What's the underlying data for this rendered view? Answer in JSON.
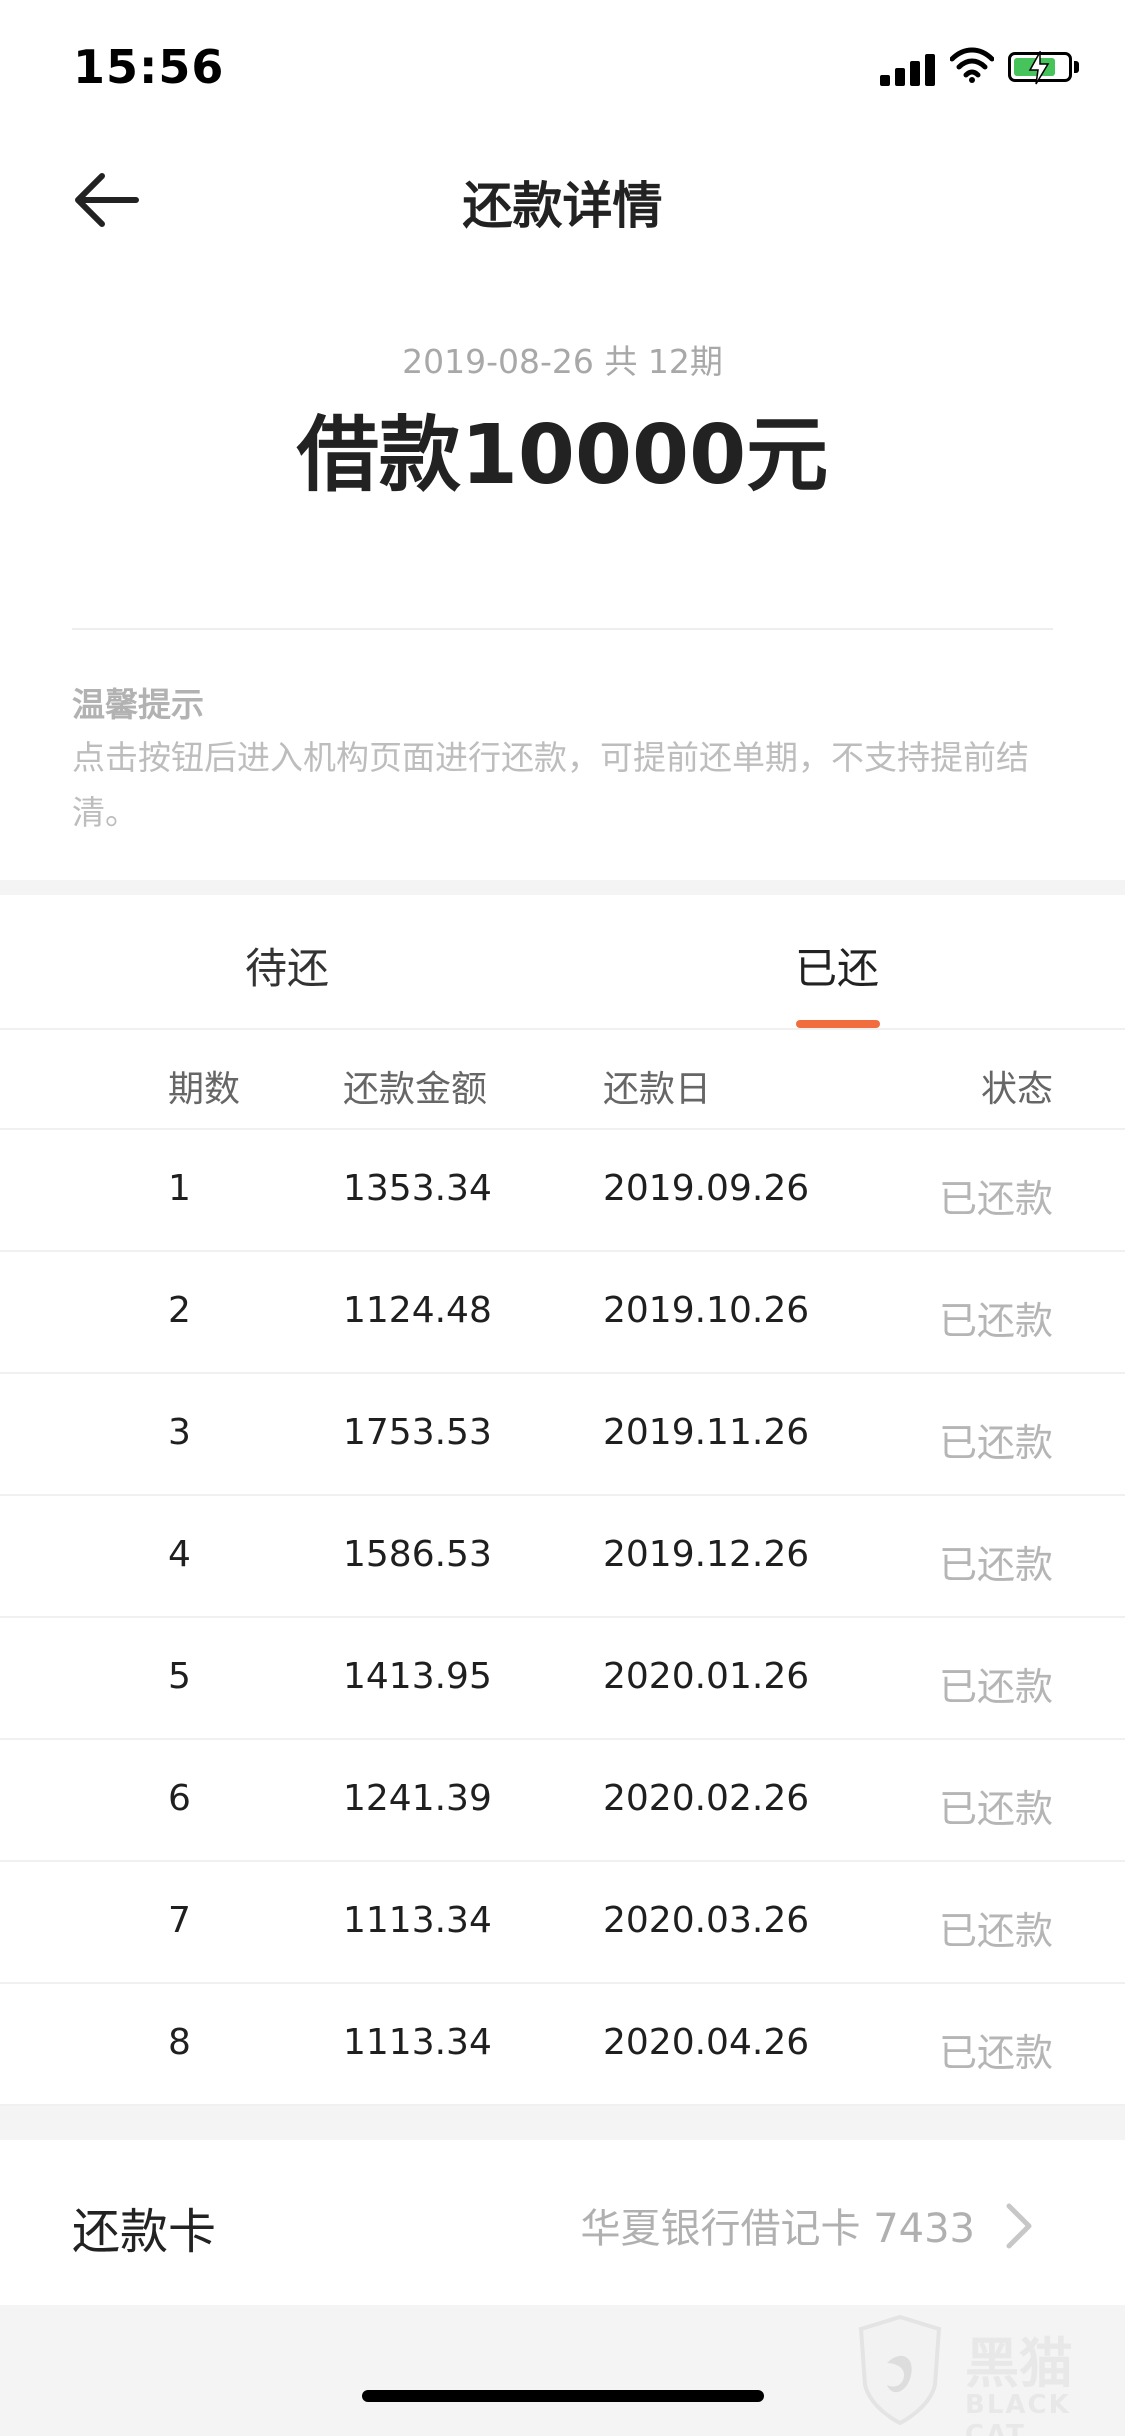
{
  "status_bar": {
    "time": "15:56"
  },
  "nav": {
    "title": "还款详情"
  },
  "summary": {
    "meta": "2019-08-26 共 12期",
    "amount": "借款10000元"
  },
  "tips": {
    "title": "温馨提示",
    "text": "点击按钮后进入机构页面进行还款，可提前还单期，不支持提前结清。"
  },
  "tabs": {
    "pending": "待还",
    "paid": "已还",
    "active": "paid",
    "accent_color": "#f26d3d"
  },
  "table": {
    "headers": [
      "期数",
      "还款金额",
      "还款日",
      "状态"
    ],
    "rows": [
      {
        "period": "1",
        "amount": "1353.34",
        "date": "2019.09.26",
        "status": "已还款"
      },
      {
        "period": "2",
        "amount": "1124.48",
        "date": "2019.10.26",
        "status": "已还款"
      },
      {
        "period": "3",
        "amount": "1753.53",
        "date": "2019.11.26",
        "status": "已还款"
      },
      {
        "period": "4",
        "amount": "1586.53",
        "date": "2019.12.26",
        "status": "已还款"
      },
      {
        "period": "5",
        "amount": "1413.95",
        "date": "2020.01.26",
        "status": "已还款"
      },
      {
        "period": "6",
        "amount": "1241.39",
        "date": "2020.02.26",
        "status": "已还款"
      },
      {
        "period": "7",
        "amount": "1113.34",
        "date": "2020.03.26",
        "status": "已还款"
      },
      {
        "period": "8",
        "amount": "1113.34",
        "date": "2020.04.26",
        "status": "已还款"
      }
    ]
  },
  "card": {
    "label": "还款卡",
    "value": "华夏银行借记卡 7433"
  },
  "watermark": {
    "text": "黑猫",
    "subtext": "BLACK CAT"
  },
  "icons": {
    "back": "back-arrow-icon",
    "chevron": "chevron-right-icon",
    "signal": "signal-icon",
    "wifi": "wifi-icon",
    "battery": "battery-charging-icon"
  }
}
